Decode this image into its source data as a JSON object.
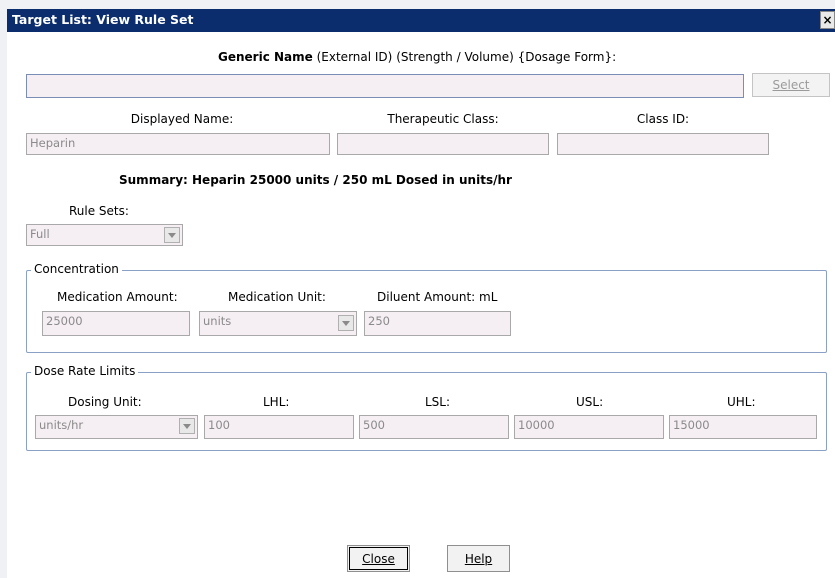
{
  "window": {
    "title": "Target List:  View Rule Set",
    "close_glyph": "×"
  },
  "header": {
    "generic_name": "Generic Name",
    "external_id": "(External ID)",
    "strength_volume": "(Strength / Volume)",
    "dosage_form": "{Dosage Form}:",
    "generic_value": "",
    "select_label": "Select"
  },
  "names": {
    "displayed_name_label": "Displayed Name:",
    "displayed_name_value": "Heparin",
    "therapeutic_class_label": "Therapeutic Class:",
    "therapeutic_class_value": "",
    "class_id_label": "Class ID:",
    "class_id_value": ""
  },
  "summary": "Summary: Heparin 25000 units / 250 mL Dosed in units/hr",
  "rule_sets": {
    "label": "Rule Sets:",
    "value": "Full"
  },
  "concentration": {
    "legend": "Concentration",
    "med_amount_label": "Medication Amount:",
    "med_amount_value": "25000",
    "med_unit_label": "Medication Unit:",
    "med_unit_value": "units",
    "diluent_label": "Diluent Amount: mL",
    "diluent_value": "250"
  },
  "dose_rate_limits": {
    "legend": "Dose Rate Limits",
    "dosing_unit_label": "Dosing Unit:",
    "dosing_unit_value": "units/hr",
    "lhl_label": "LHL:",
    "lhl_value": "100",
    "lsl_label": "LSL:",
    "lsl_value": "500",
    "usl_label": "USL:",
    "usl_value": "10000",
    "uhl_label": "UHL:",
    "uhl_value": "15000"
  },
  "footer": {
    "close_label": "Close",
    "help_label": "Help"
  }
}
